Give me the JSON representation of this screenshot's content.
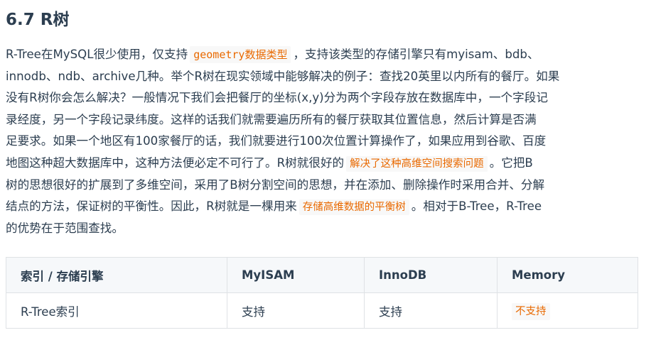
{
  "section": {
    "title": "6.7 R树"
  },
  "paragraph": {
    "l1_a": "R-Tree在MySQL很少使用，仅支持",
    "l1_code": "geometry数据类型",
    "l1_b": "，支持该类型的存储引擎只有myisam、bdb、",
    "l2": "innodb、ndb、archive几种。举个R树在现实领域中能够解决的例子：查找20英里以内所有的餐厅。如果",
    "l3": "没有R树你会怎么解决？一般情况下我们会把餐厅的坐标(x,y)分为两个字段存放在数据库中，一个字段记",
    "l4": "录经度，另一个字段记录纬度。这样的话我们就需要遍历所有的餐厅获取其位置信息，然后计算是否满",
    "l5": "足要求。如果一个地区有100家餐厅的话，我们就要进行100次位置计算操作了，如果应用到谷歌、百度",
    "l6_a": "地图这种超大数据库中，这种方法便必定不可行了。R树就很好的",
    "l6_hl": "解决了这种高维空间搜索问题",
    "l6_b": "。它把B",
    "l7": "树的思想很好的扩展到了多维空间，采用了B树分割空间的思想，并在添加、删除操作时采用合并、分解",
    "l8_a": "结点的方法，保证树的平衡性。因此，R树就是一棵用来",
    "l8_hl": "存储高维数据的平衡树",
    "l8_b": "。相对于B-Tree，R-Tree",
    "l9": "的优势在于范围查找。"
  },
  "table": {
    "headers": [
      "索引 / 存储引擎",
      "MyISAM",
      "InnoDB",
      "Memory"
    ],
    "rows": [
      [
        "R-Tree索引",
        "支持",
        "支持",
        "不支持"
      ]
    ]
  },
  "colors": {
    "text": "#2c3e50",
    "code_accent": "#e96900",
    "code_bg": "#f8f8f8",
    "table_border": "#dfe2e5",
    "table_header_bg": "#f6f8fa"
  }
}
